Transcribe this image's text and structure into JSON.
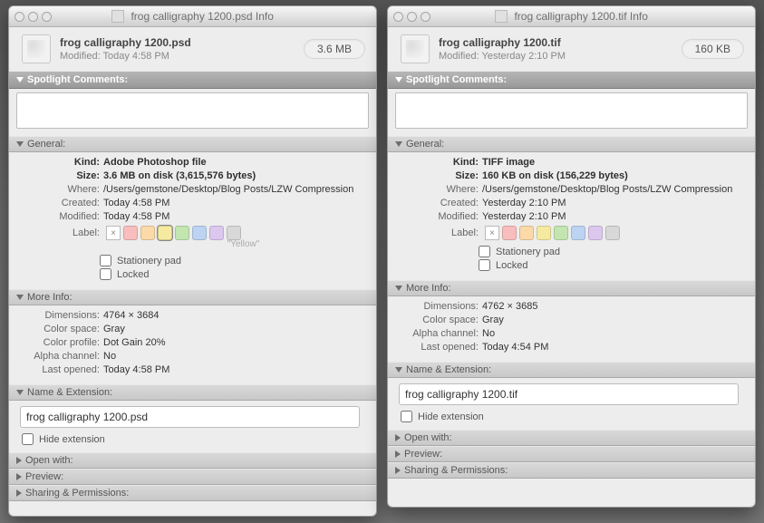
{
  "labels": {
    "spotlight": "Spotlight Comments:",
    "general": "General:",
    "moreinfo": "More Info:",
    "nameext": "Name & Extension:",
    "openwith": "Open with:",
    "preview": "Preview:",
    "sharing": "Sharing & Permissions:",
    "kind": "Kind:",
    "size": "Size:",
    "where": "Where:",
    "created": "Created:",
    "modified": "Modified:",
    "label": "Label:",
    "stationery": "Stationery pad",
    "locked": "Locked",
    "dimensions": "Dimensions:",
    "colorspace": "Color space:",
    "colorprofile": "Color profile:",
    "alpha": "Alpha channel:",
    "lastopened": "Last opened:",
    "hideext": "Hide extension",
    "modified_prefix": "Modified:",
    "label_hint": "\"Yellow\""
  },
  "left": {
    "winTitle": "frog calligraphy 1200.psd Info",
    "name": "frog calligraphy 1200.psd",
    "modHeader": "Today 4:58 PM",
    "sizePill": "3.6 MB",
    "kind": "Adobe Photoshop file",
    "size": "3.6 MB on disk (3,615,576 bytes)",
    "where": "/Users/gemstone/Desktop/Blog Posts/LZW Compression",
    "created": "Today 4:58 PM",
    "modified": "Today 4:58 PM",
    "dimensions": "4764 × 3684",
    "colorspace": "Gray",
    "colorprofile": "Dot Gain 20%",
    "alpha": "No",
    "lastopened": "Today 4:58 PM",
    "filename": "frog calligraphy 1200.psd",
    "showLabelHint": true,
    "showColorProfile": true,
    "selectedLabel": "yellow"
  },
  "right": {
    "winTitle": "frog calligraphy 1200.tif Info",
    "name": "frog calligraphy 1200.tif",
    "modHeader": "Yesterday 2:10 PM",
    "sizePill": "160 KB",
    "kind": "TIFF image",
    "size": "160 KB on disk (156,229 bytes)",
    "where": "/Users/gemstone/Desktop/Blog Posts/LZW Compression",
    "created": "Yesterday 2:10 PM",
    "modified": "Yesterday 2:10 PM",
    "dimensions": "4762 × 3685",
    "colorspace": "Gray",
    "alpha": "No",
    "lastopened": "Today 4:54 PM",
    "filename": "frog calligraphy 1200.tif",
    "showLabelHint": false,
    "showColorProfile": false,
    "selectedLabel": null
  }
}
